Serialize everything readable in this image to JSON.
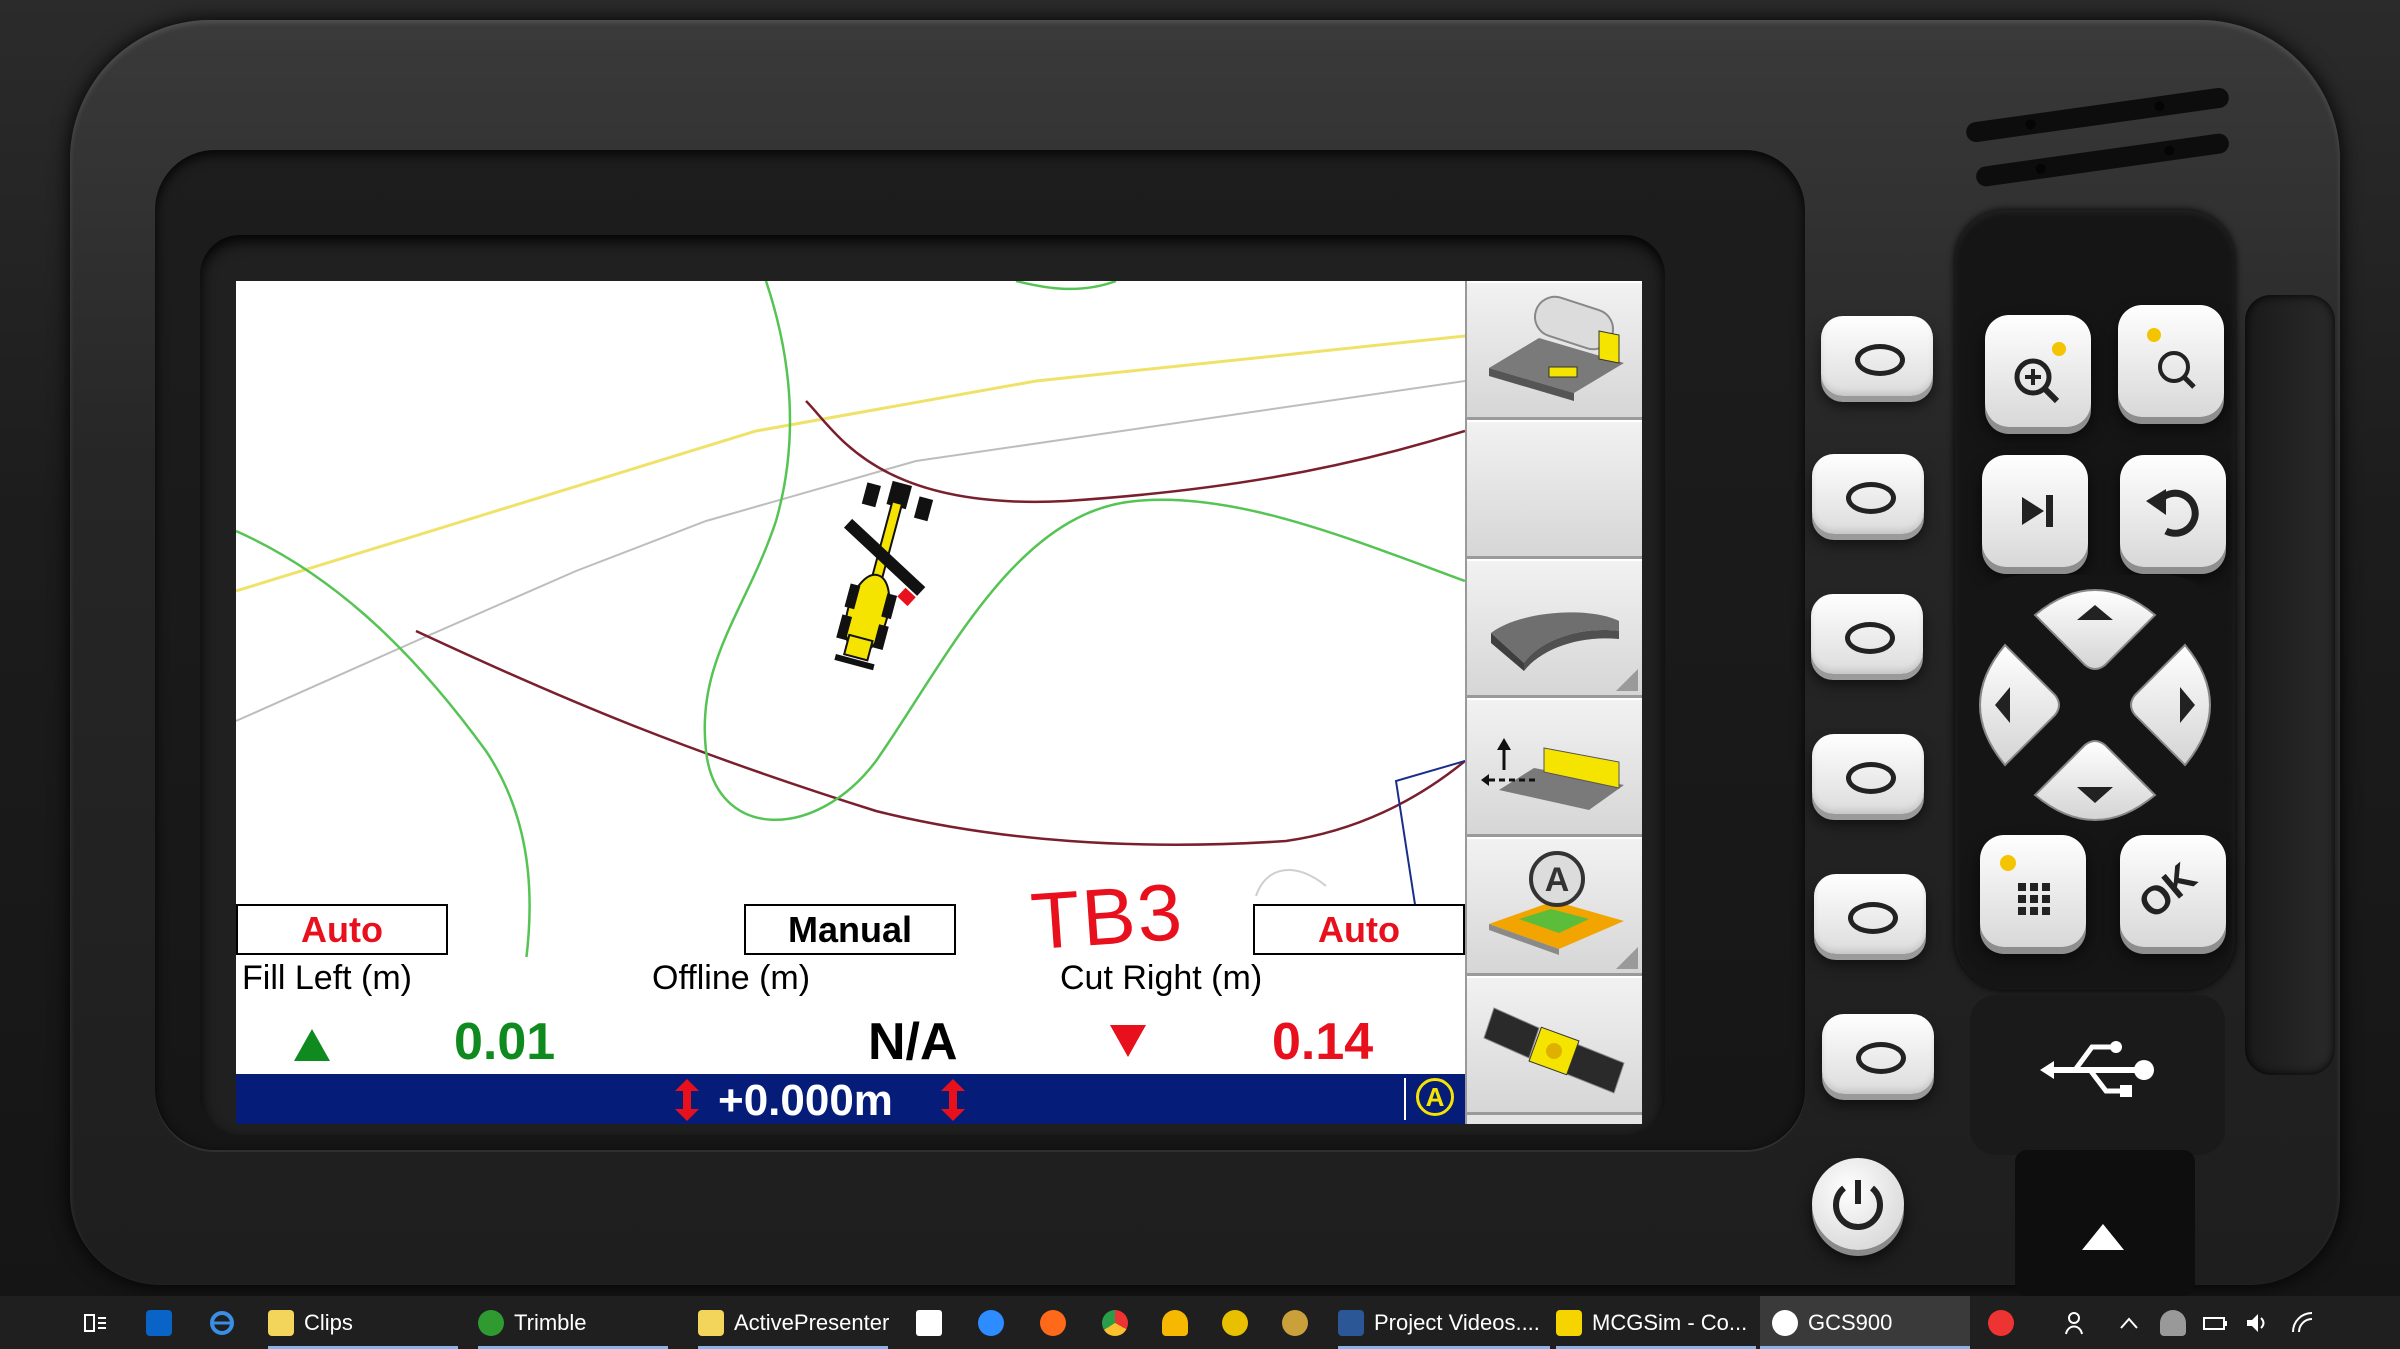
{
  "screen": {
    "modes": {
      "left": "Auto",
      "center": "Manual",
      "right": "Auto"
    },
    "overlay_label": "TB3",
    "readouts": {
      "fill_left": {
        "label": "Fill Left (m)",
        "value": "0.01"
      },
      "offline": {
        "label": "Offline (m)",
        "value": "N/A"
      },
      "cut_right": {
        "label": "Cut Right (m)",
        "value": "0.14"
      }
    },
    "status_bar": {
      "height_value": "+0.000m",
      "auto_badge": "A"
    },
    "toolbar": [
      {
        "name": "blade-view-icon"
      },
      {
        "name": "empty-softkey"
      },
      {
        "name": "surface-view-icon"
      },
      {
        "name": "offset-icon"
      },
      {
        "name": "auto-surface-icon"
      },
      {
        "name": "satellite-icon"
      }
    ],
    "colors": {
      "fill_green": "#0f8a1e",
      "cut_red": "#e8101c",
      "status_blue": "#061c79",
      "machine_yellow": "#f5e400"
    }
  },
  "keypad": {
    "ok_label": "OK",
    "keys": [
      "zoom-in-icon",
      "zoom-out-icon",
      "skip-icon",
      "undo-icon",
      "arrow-up-icon",
      "arrow-left-icon",
      "arrow-right-icon",
      "arrow-down-icon",
      "keypad-icon",
      "ok-icon",
      "usb-icon",
      "eject-icon",
      "power-icon"
    ]
  },
  "taskbar": {
    "items": [
      {
        "label": "Clips"
      },
      {
        "label": "Trimble"
      },
      {
        "label": "ActivePresenter"
      },
      {
        "label": "Project Videos...."
      },
      {
        "label": "MCGSim - Co..."
      },
      {
        "label": "GCS900"
      }
    ]
  }
}
